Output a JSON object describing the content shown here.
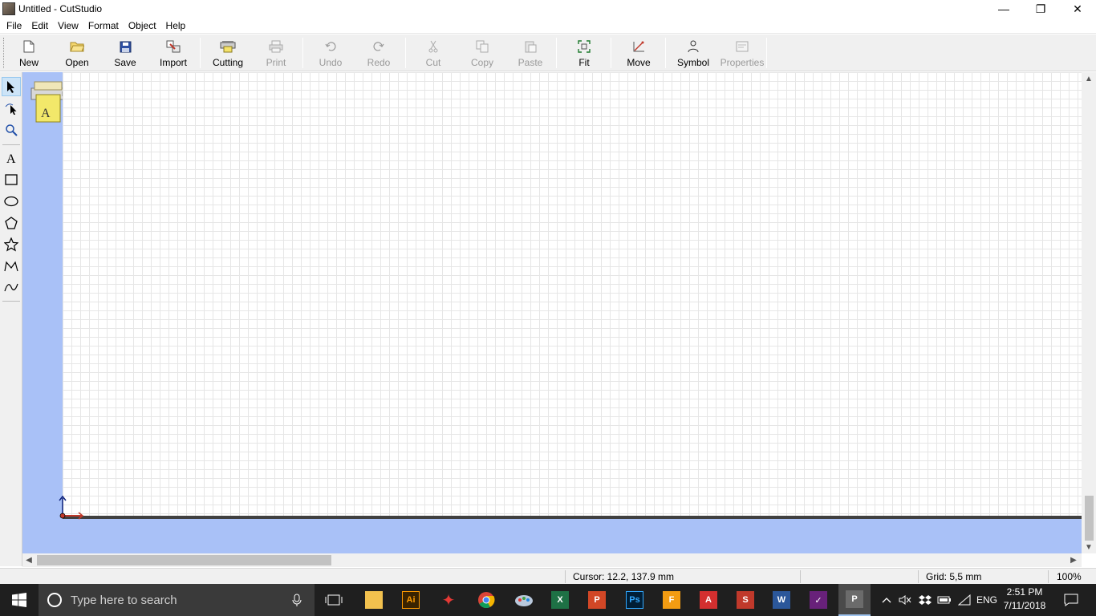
{
  "window": {
    "title": "Untitled - CutStudio",
    "controls": {
      "minimize": "—",
      "restore": "❐",
      "close": "✕"
    }
  },
  "menu": [
    "File",
    "Edit",
    "View",
    "Format",
    "Object",
    "Help"
  ],
  "toolbar": {
    "new": "New",
    "open": "Open",
    "save": "Save",
    "import": "Import",
    "cutting": "Cutting",
    "print": "Print",
    "undo": "Undo",
    "redo": "Redo",
    "cut": "Cut",
    "copy": "Copy",
    "paste": "Paste",
    "fit": "Fit",
    "move": "Move",
    "symbol": "Symbol",
    "properties": "Properties"
  },
  "palette": [
    "select",
    "node-edit",
    "zoom",
    "text",
    "rectangle",
    "ellipse",
    "polygon",
    "star",
    "polyline",
    "curve"
  ],
  "status": {
    "cursor": "Cursor: 12.2, 137.9 mm",
    "grid": "Grid: 5,5 mm",
    "zoom": "100%"
  },
  "taskbar": {
    "search_placeholder": "Type here to search",
    "apps": [
      {
        "name": "file-explorer",
        "label": "",
        "color": "#f2c14e"
      },
      {
        "name": "illustrator",
        "label": "Ai",
        "color": "#ff9a00"
      },
      {
        "name": "red-app",
        "label": "✦",
        "color": "#d62b2b"
      },
      {
        "name": "chrome",
        "label": "",
        "color": "#4285f4"
      },
      {
        "name": "paint-app",
        "label": "",
        "color": "#7aa0c8"
      },
      {
        "name": "excel",
        "label": "X",
        "color": "#1e7145"
      },
      {
        "name": "powerpoint",
        "label": "P",
        "color": "#d24726"
      },
      {
        "name": "photoshop",
        "label": "Ps",
        "color": "#001e36"
      },
      {
        "name": "foxit",
        "label": "F",
        "color": "#f39c12"
      },
      {
        "name": "acrobat",
        "label": "A",
        "color": "#d32f2f"
      },
      {
        "name": "sketchup",
        "label": "S",
        "color": "#c0392b"
      },
      {
        "name": "word",
        "label": "W",
        "color": "#2b579a"
      },
      {
        "name": "visual-studio",
        "label": "✓",
        "color": "#68217a"
      },
      {
        "name": "cutstudio",
        "label": "P",
        "color": "#6b6b6b"
      }
    ],
    "lang": "ENG",
    "time": "2:51 PM",
    "date": "7/11/2018"
  }
}
